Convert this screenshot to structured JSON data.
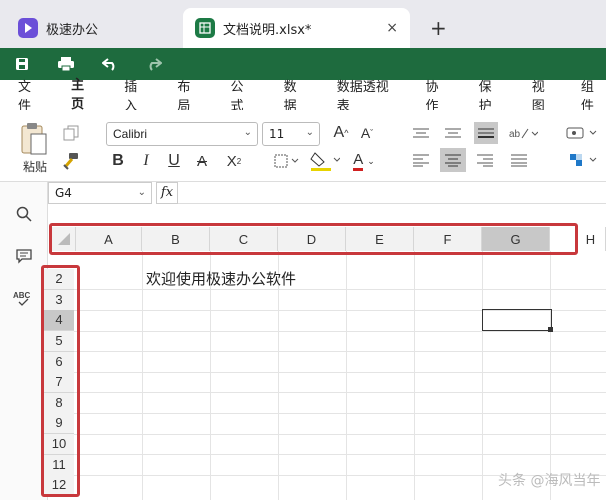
{
  "tabs": [
    {
      "label": "极速办公",
      "icon": "app-logo-icon",
      "color": "#6b4fd8"
    },
    {
      "label": "文档说明.xlsx*",
      "icon": "spreadsheet-icon",
      "color": "#1d7a45"
    }
  ],
  "tab_close": "×",
  "new_tab": "+",
  "menu": [
    "文件",
    "主页",
    "插入",
    "布局",
    "公式",
    "数据",
    "数据透视表",
    "协作",
    "保护",
    "视图",
    "组件"
  ],
  "menu_active": "主页",
  "ribbon": {
    "paste_label": "粘贴",
    "font_name": "Calibri",
    "font_size": "11",
    "bold": "B",
    "italic": "I",
    "underline": "U",
    "strike": "A",
    "subscript": "X",
    "grow_font": "A",
    "shrink_font": "A",
    "font_color": "A"
  },
  "name_box": "G4",
  "fx": "fx",
  "columns": [
    "A",
    "B",
    "C",
    "D",
    "E",
    "F",
    "G",
    "H"
  ],
  "selected_column": "G",
  "rows": [
    "2",
    "3",
    "4",
    "5",
    "6",
    "7",
    "8",
    "9",
    "10",
    "11",
    "12"
  ],
  "selected_row": "4",
  "cell_text": "欢迎使用极速办公软件",
  "watermark": "头条 @海风当年",
  "colors": {
    "accent": "#1d7a45",
    "highlight": "#c8383c"
  }
}
